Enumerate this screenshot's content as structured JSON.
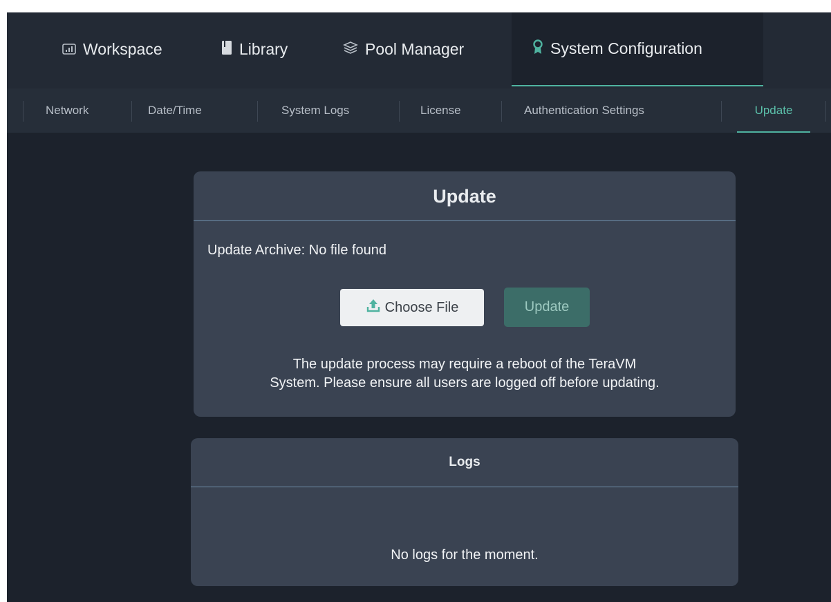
{
  "topnav": {
    "items": [
      {
        "label": "Workspace",
        "icon": "chart-icon"
      },
      {
        "label": "Library",
        "icon": "book-icon"
      },
      {
        "label": "Pool Manager",
        "icon": "layers-icon"
      },
      {
        "label": "System Configuration",
        "icon": "award-icon",
        "active": true
      }
    ]
  },
  "subnav": {
    "tabs": [
      {
        "label": "Network"
      },
      {
        "label": "Date/Time"
      },
      {
        "label": "System Logs"
      },
      {
        "label": "License"
      },
      {
        "label": "Authentication Settings"
      },
      {
        "label": "Update",
        "active": true
      }
    ]
  },
  "update_panel": {
    "title": "Update",
    "archive_label": "Update Archive: No file found",
    "choose_file_label": "Choose File",
    "update_button_label": "Update",
    "notice_line1": "The update process may require a reboot of the TeraVM",
    "notice_line2": "System. Please ensure all users are logged off before updating."
  },
  "logs_panel": {
    "title": "Logs",
    "empty_text": "No logs for the moment."
  },
  "colors": {
    "accent": "#4fb3a0",
    "background": "#1c222c",
    "panel": "#3a4352",
    "update_button": "#3c6d68"
  }
}
